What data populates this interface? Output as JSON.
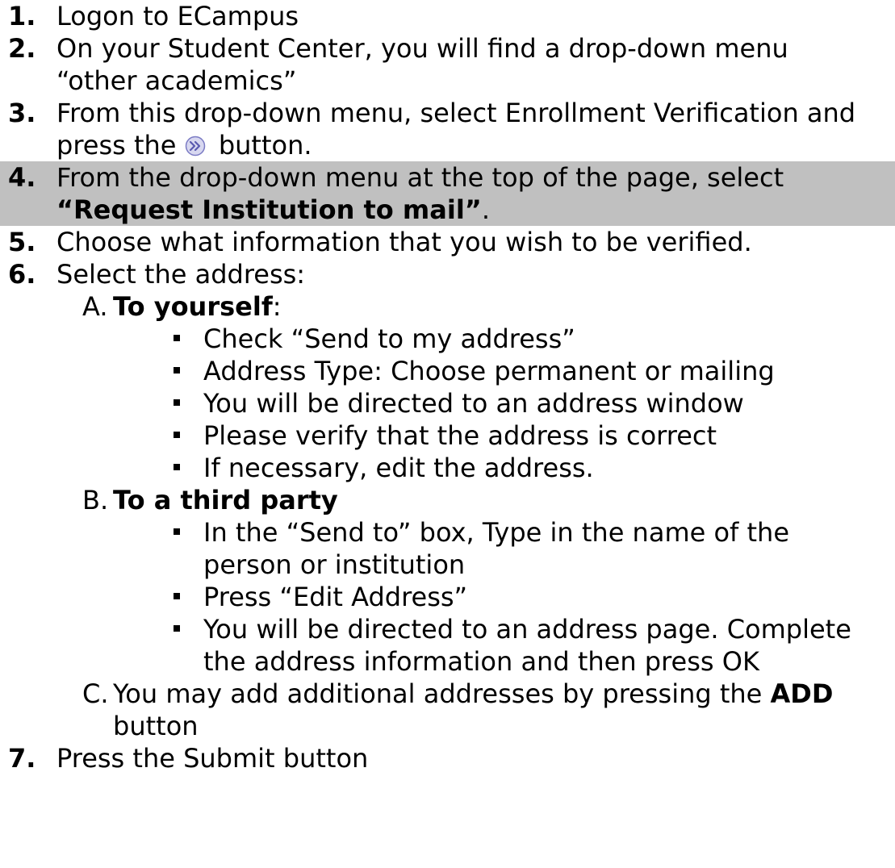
{
  "steps": [
    {
      "num": "1.",
      "lines": [
        "Logon to ECampus"
      ]
    },
    {
      "num": "2.",
      "lines": [
        "On your Student Center, you will find a drop-down menu",
        "“other academics”"
      ]
    },
    {
      "num": "3.",
      "line1": "From this drop-down menu, select Enrollment Verification and",
      "line2_pre": "press the",
      "line2_post": "button."
    },
    {
      "num": "4.",
      "line1": "From the drop-down menu at the top of the page, select",
      "line2_bold": "“Request Institution to mail”",
      "line2_post": "."
    },
    {
      "num": "5.",
      "lines": [
        "Choose what information that you wish to be verified."
      ]
    },
    {
      "num": "6.",
      "lines": [
        "Select the address:"
      ]
    },
    {
      "num": "7.",
      "lines": [
        "Press the Submit button"
      ]
    }
  ],
  "subA": {
    "letter": "A.",
    "title": "To yourself",
    "suffix": ":",
    "bullets": [
      "Check “Send to my address”",
      "Address Type: Choose permanent or mailing",
      "You will be directed to an address window",
      "Please verify that the address is correct",
      "If necessary, edit the address."
    ]
  },
  "subB": {
    "letter": "B.",
    "title": "To a third party",
    "bullets": [
      [
        "In the “Send to” box, Type in the name of the",
        "person or institution"
      ],
      [
        "Press “Edit Address”"
      ],
      [
        "You will be directed to an address page. Complete",
        "the address information and then press OK"
      ]
    ]
  },
  "subC": {
    "letter": "C.",
    "pre": "You may add additional addresses by pressing the",
    "bold": "ADD",
    "line2": "button"
  },
  "colors": {
    "highlight": "#c0c0c0",
    "icon_fill": "#d8d8f0",
    "icon_stroke": "#7b7bc4"
  },
  "icons": {
    "go_button": "double-chevron-right-icon"
  }
}
